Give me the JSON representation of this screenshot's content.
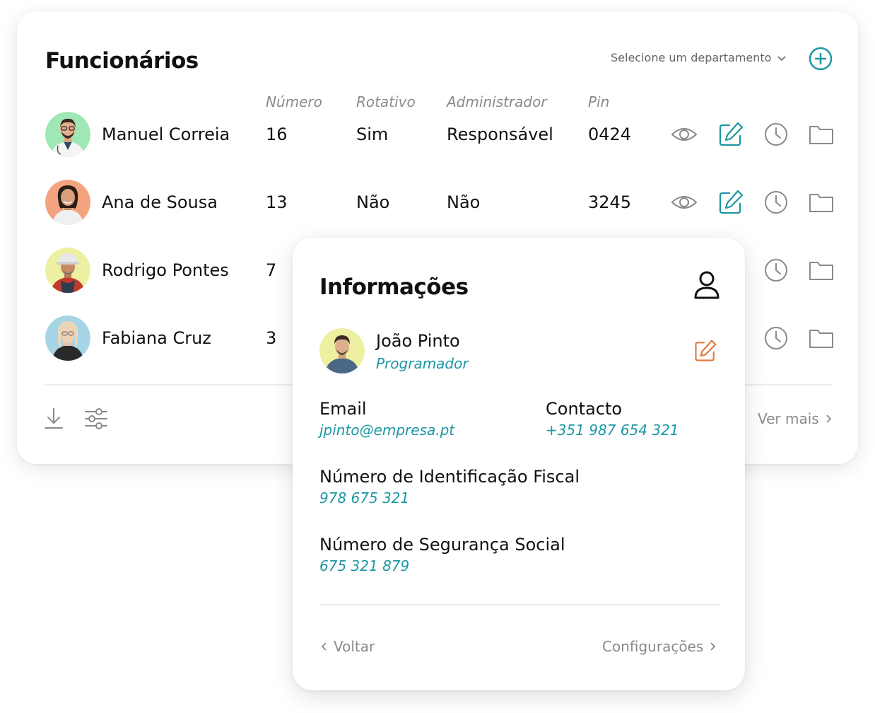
{
  "list": {
    "title": "Funcionários",
    "department_placeholder": "Selecione um departamento",
    "columns": [
      "Número",
      "Rotativo",
      "Administrador",
      "Pin"
    ],
    "rows": [
      {
        "name": "Manuel Correia",
        "number": "16",
        "rotativo": "Sim",
        "admin": "Responsável",
        "pin": "0424",
        "avatar_bg": "#9fe8b5"
      },
      {
        "name": "Ana de Sousa",
        "number": "13",
        "rotativo": "Não",
        "admin": "Não",
        "pin": "3245",
        "avatar_bg": "#f3a37e"
      },
      {
        "name": "Rodrigo Pontes",
        "number": "7",
        "avatar_bg": "#ecf0a0"
      },
      {
        "name": "Fabiana Cruz",
        "number": "3",
        "avatar_bg": "#a6d5e6"
      }
    ],
    "more_label": "Ver mais"
  },
  "popup": {
    "title": "Informações",
    "user": {
      "name": "João Pinto",
      "role": "Programador",
      "avatar_bg": "#ecf0a0"
    },
    "email": {
      "label": "Email",
      "value": "jpinto@empresa.pt"
    },
    "contact": {
      "label": "Contacto",
      "value": "+351 987 654 321"
    },
    "nif": {
      "label": "Número de Identificação Fiscal",
      "value": "978 675 321"
    },
    "nss": {
      "label": "Número de Segurança Social",
      "value": "675 321 879"
    },
    "back_label": "Voltar",
    "settings_label": "Configurações"
  },
  "colors": {
    "accent": "#1b97a3",
    "edit_orange": "#e07a3f",
    "muted": "#8a8a8a"
  },
  "icons": [
    "add-icon",
    "chevron-down-icon",
    "eye-icon",
    "edit-icon",
    "clock-icon",
    "folder-icon",
    "download-icon",
    "filter-icon",
    "user-icon",
    "chevron-left-icon",
    "chevron-right-icon"
  ]
}
